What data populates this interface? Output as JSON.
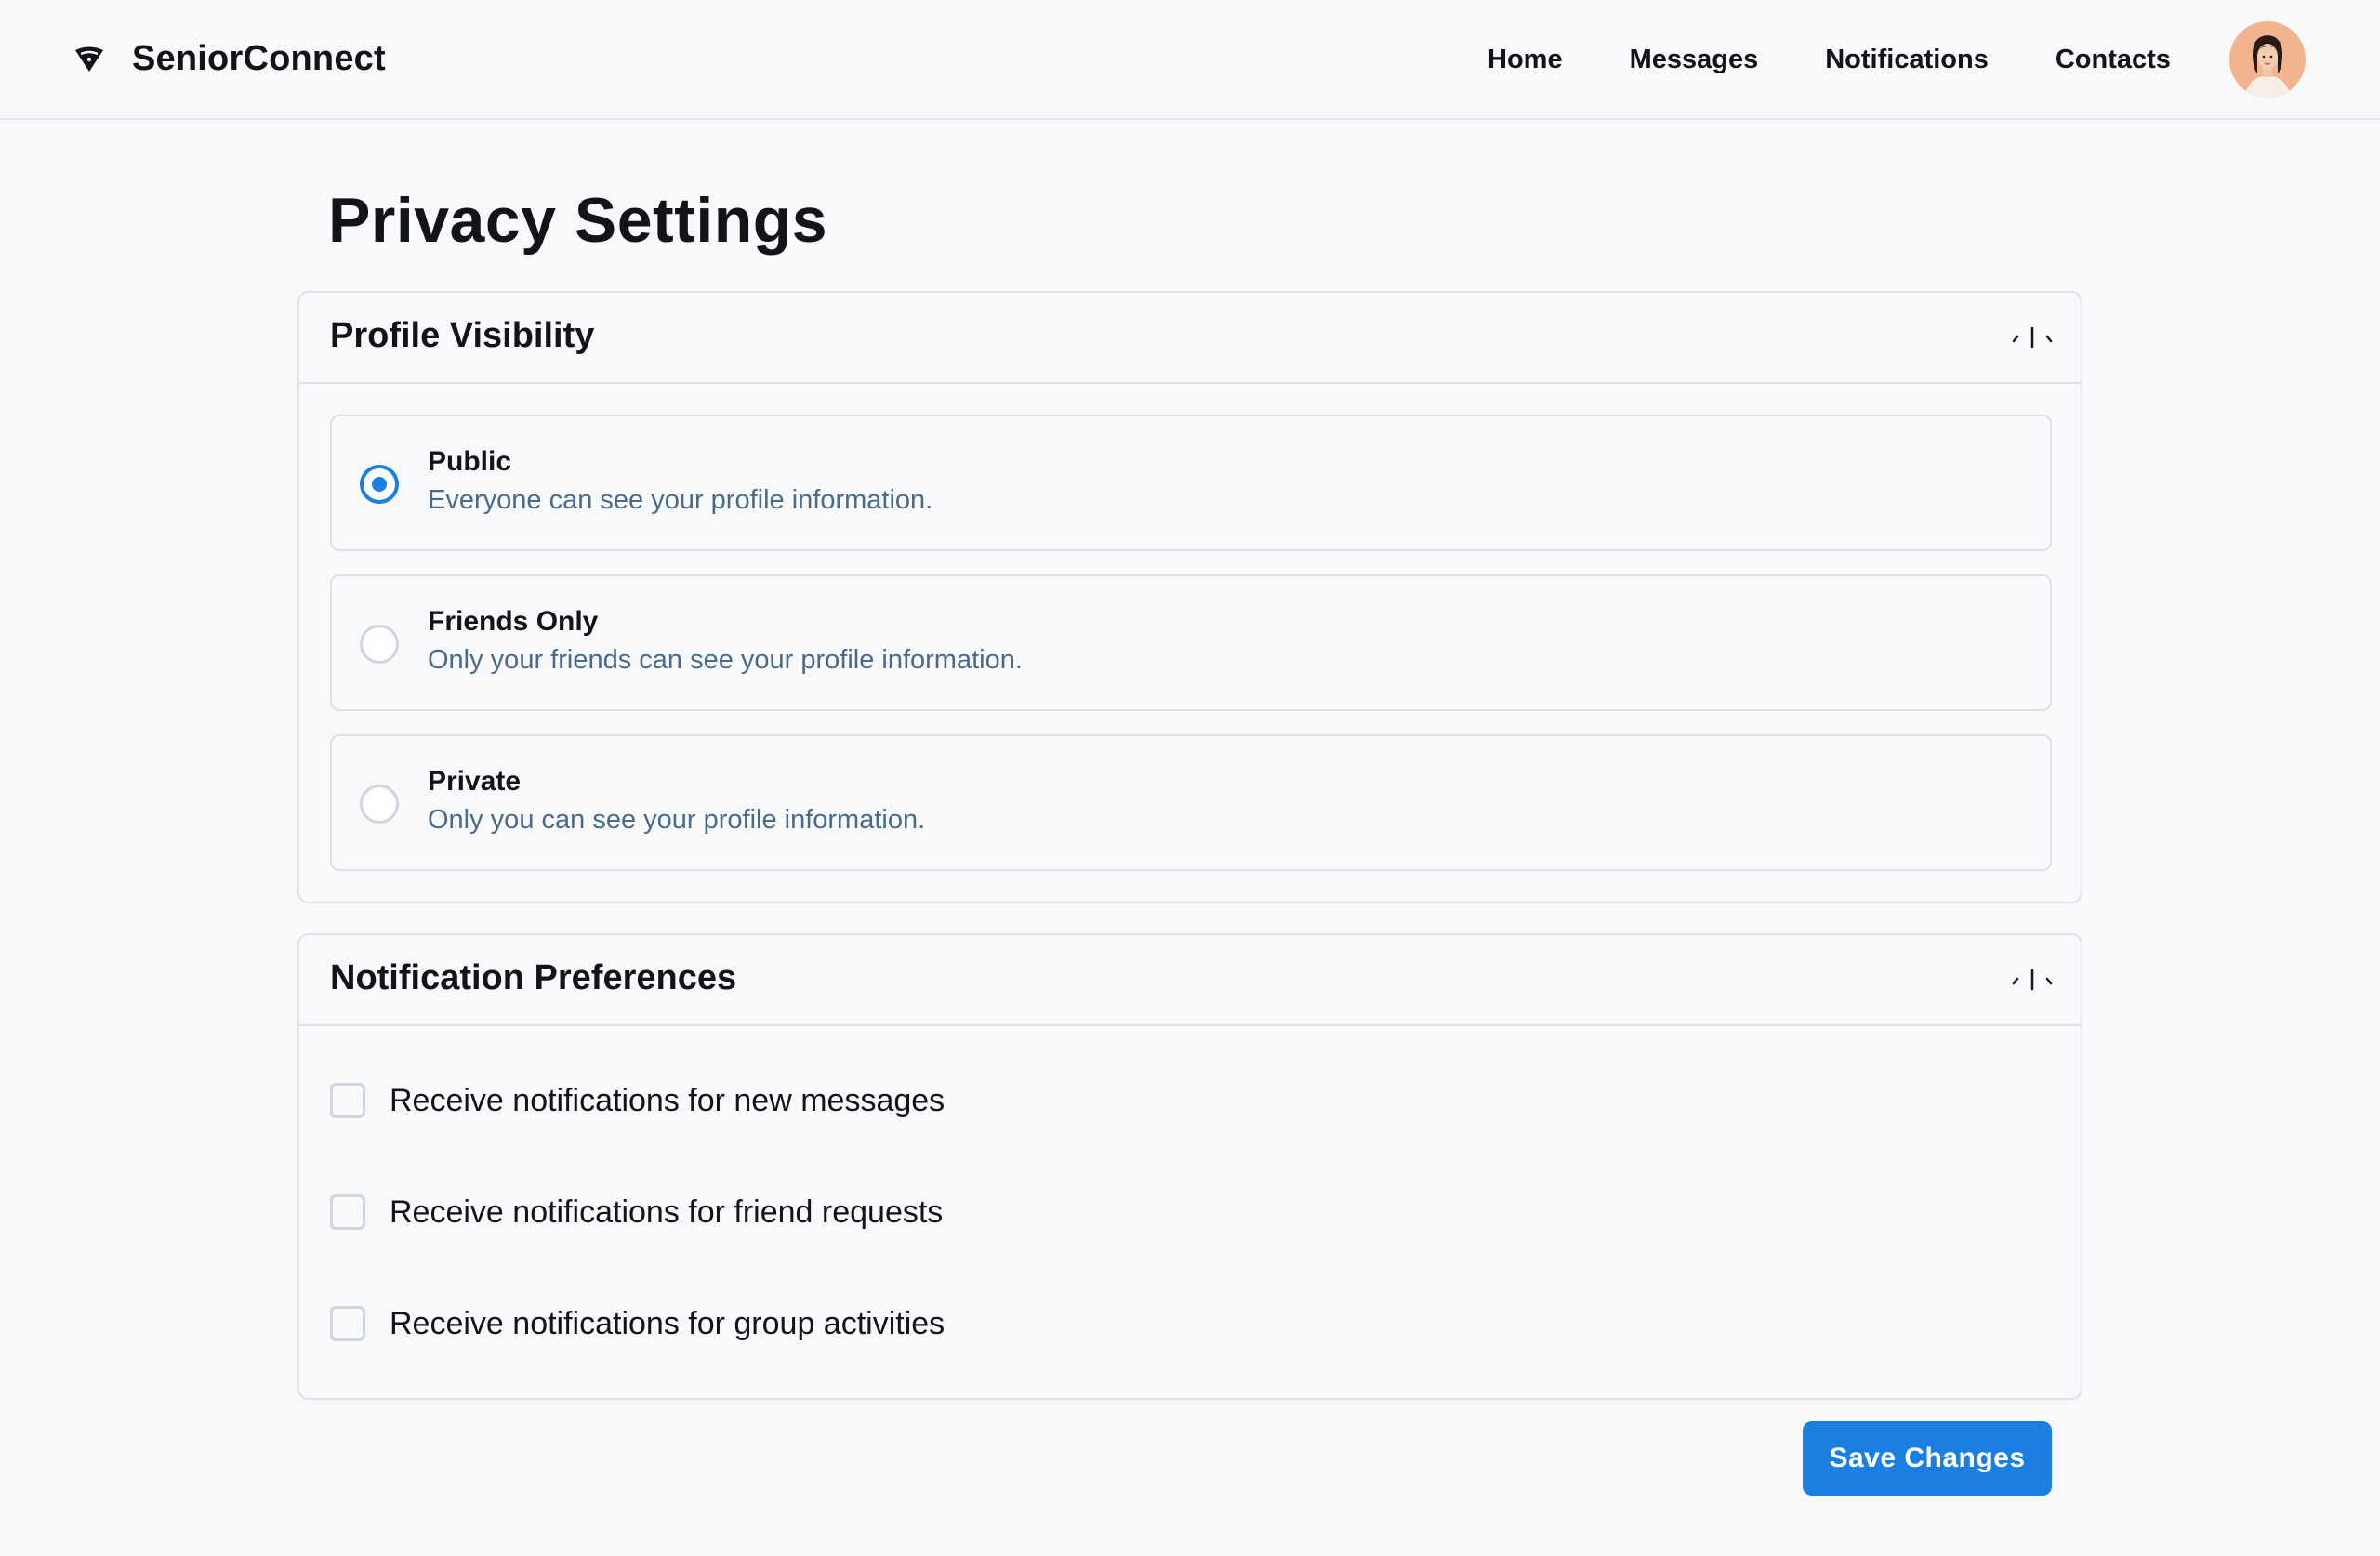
{
  "app": {
    "name": "SeniorConnect",
    "logo_icon": "network-signal-icon"
  },
  "nav": {
    "items": [
      {
        "label": "Home"
      },
      {
        "label": "Messages"
      },
      {
        "label": "Notifications"
      },
      {
        "label": "Contacts"
      }
    ],
    "avatar_icon": "user-avatar"
  },
  "page": {
    "title": "Privacy Settings"
  },
  "profile_visibility": {
    "title": "Profile Visibility",
    "toggle_icon": "collapse-toggle-icon",
    "options": [
      {
        "label": "Public",
        "description": "Everyone can see your profile information.",
        "selected": true
      },
      {
        "label": "Friends Only",
        "description": "Only your friends can see your profile information.",
        "selected": false
      },
      {
        "label": "Private",
        "description": "Only you can see your profile information.",
        "selected": false
      }
    ]
  },
  "notification_preferences": {
    "title": "Notification Preferences",
    "toggle_icon": "collapse-toggle-icon",
    "options": [
      {
        "label": "Receive notifications for new messages",
        "checked": false
      },
      {
        "label": "Receive notifications for friend requests",
        "checked": false
      },
      {
        "label": "Receive notifications for group activities",
        "checked": false
      }
    ]
  },
  "actions": {
    "save_label": "Save Changes"
  },
  "colors": {
    "accent": "#1a7fe0",
    "description_text": "#4a6a8c",
    "border": "#dde2e8",
    "background": "#f8f9fb"
  }
}
